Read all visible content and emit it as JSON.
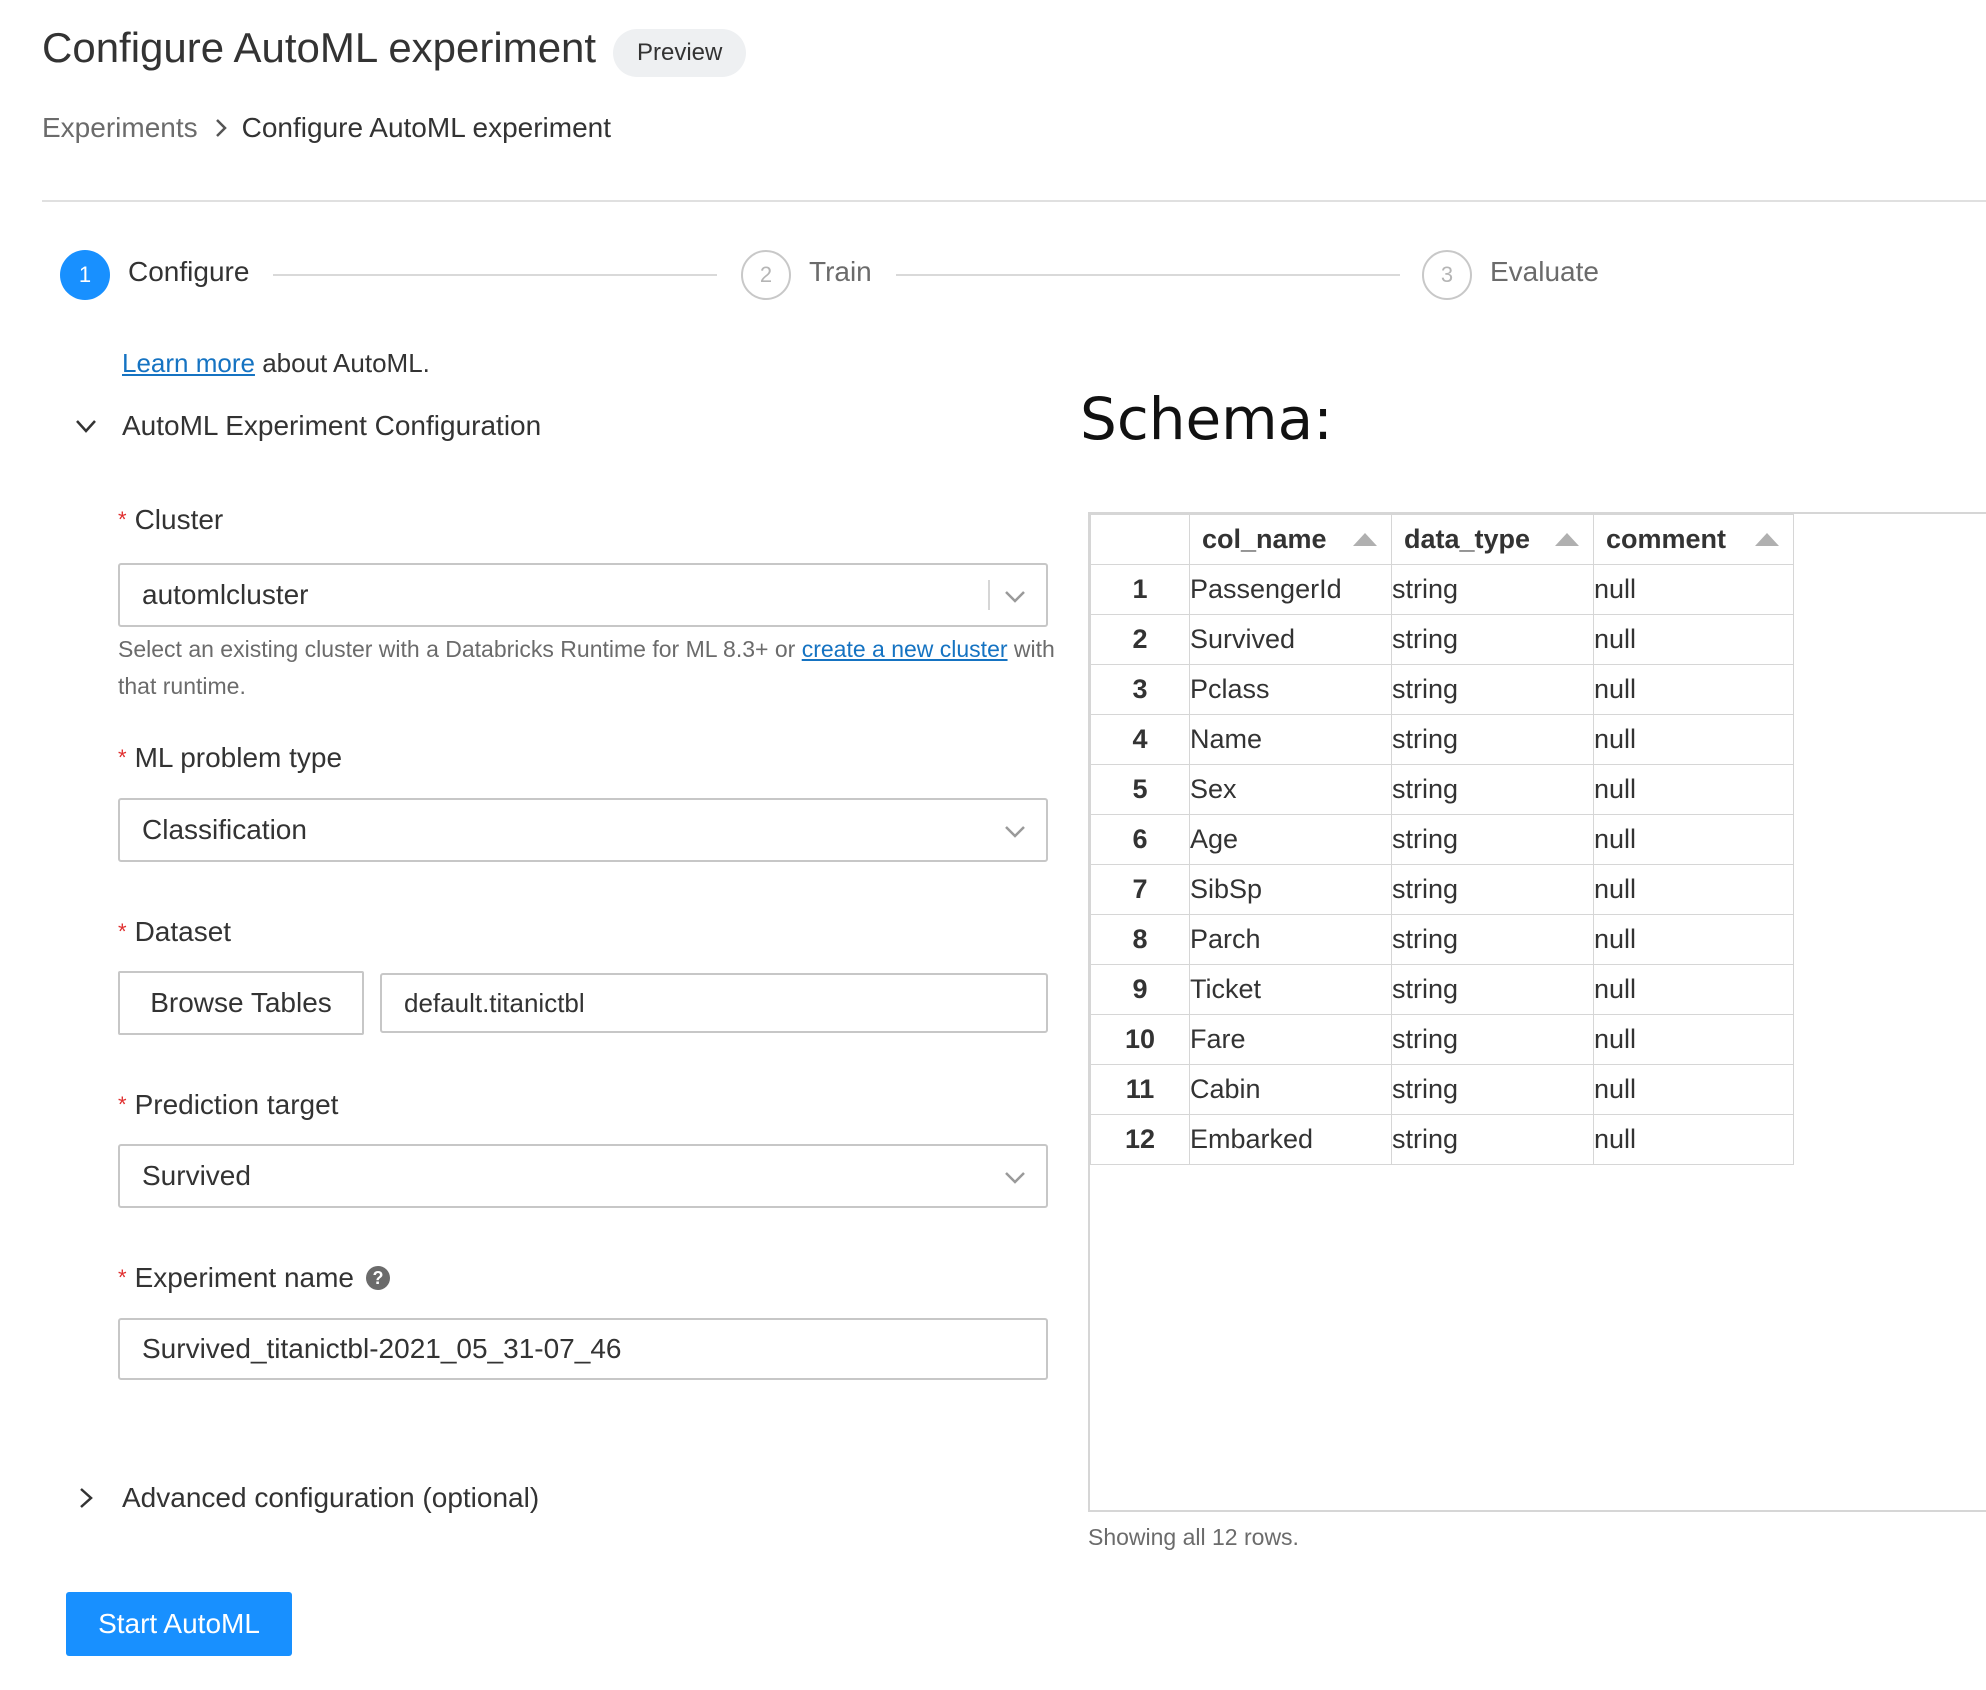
{
  "header": {
    "title": "Configure AutoML experiment",
    "badge": "Preview",
    "breadcrumb": {
      "parent": "Experiments",
      "current": "Configure AutoML experiment"
    }
  },
  "steps": [
    {
      "number": "1",
      "label": "Configure",
      "active": true
    },
    {
      "number": "2",
      "label": "Train",
      "active": false
    },
    {
      "number": "3",
      "label": "Evaluate",
      "active": false
    }
  ],
  "intro": {
    "link": "Learn more",
    "text": " about AutoML."
  },
  "config_section": {
    "title": "AutoML Experiment Configuration"
  },
  "form": {
    "required_mark": "*",
    "cluster": {
      "label": "Cluster",
      "value": "automlcluster",
      "help_before": "Select an existing cluster with a Databricks Runtime for ML 8.3+ or ",
      "help_link": "create a new cluster",
      "help_after": " with that runtime."
    },
    "problem_type": {
      "label": "ML problem type",
      "value": "Classification"
    },
    "dataset": {
      "label": "Dataset",
      "browse_label": "Browse Tables",
      "value": "default.titanictbl"
    },
    "target": {
      "label": "Prediction target",
      "value": "Survived"
    },
    "experiment": {
      "label": "Experiment name",
      "help_icon": "?",
      "value": "Survived_titanictbl-2021_05_31-07_46"
    }
  },
  "advanced": {
    "title": "Advanced configuration (optional)"
  },
  "start_button": "Start AutoML",
  "schema": {
    "title": "Schema:",
    "columns": [
      "col_name",
      "data_type",
      "comment"
    ],
    "rows": [
      [
        "1",
        "PassengerId",
        "string",
        "null"
      ],
      [
        "2",
        "Survived",
        "string",
        "null"
      ],
      [
        "3",
        "Pclass",
        "string",
        "null"
      ],
      [
        "4",
        "Name",
        "string",
        "null"
      ],
      [
        "5",
        "Sex",
        "string",
        "null"
      ],
      [
        "6",
        "Age",
        "string",
        "null"
      ],
      [
        "7",
        "SibSp",
        "string",
        "null"
      ],
      [
        "8",
        "Parch",
        "string",
        "null"
      ],
      [
        "9",
        "Ticket",
        "string",
        "null"
      ],
      [
        "10",
        "Fare",
        "string",
        "null"
      ],
      [
        "11",
        "Cabin",
        "string",
        "null"
      ],
      [
        "12",
        "Embarked",
        "string",
        "null"
      ]
    ],
    "footer": "Showing all 12 rows."
  },
  "colors": {
    "primary": "#1890ff",
    "link": "#1573c2",
    "required": "#e02f2f"
  },
  "icons": [
    "chevron-right-icon",
    "chevron-down-icon",
    "help-icon",
    "sort-ascending-icon"
  ]
}
